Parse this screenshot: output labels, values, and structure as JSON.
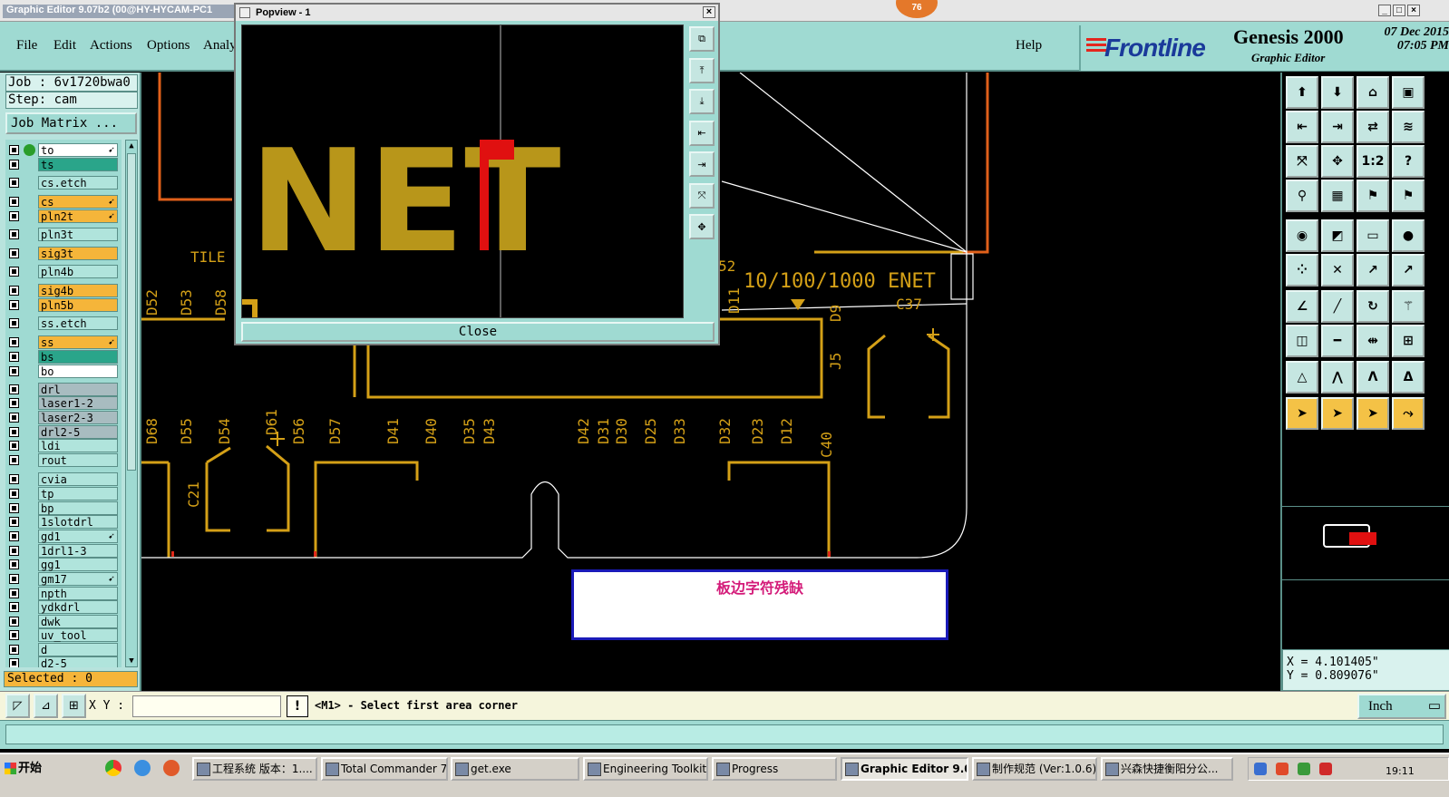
{
  "titlebar": {
    "title": "Graphic Editor 9.07b2 (00@HY-HYCAM-PC1",
    "badge": "76",
    "minimize": "_",
    "maximize": "□",
    "close": "×"
  },
  "menu": {
    "items": [
      "File",
      "Edit",
      "Actions",
      "Options",
      "Analy"
    ],
    "help": "Help"
  },
  "brand": {
    "logo": "Frontline",
    "product": "Genesis 2000",
    "subtitle": "Graphic Editor",
    "date": "07 Dec 2015",
    "time": "07:05 PM"
  },
  "job": {
    "job_label": "Job : 6v1720bwa0",
    "step_label": "Step: cam",
    "matrix_button": "Job Matrix ..."
  },
  "layers": [
    {
      "name": "to",
      "color": "white",
      "arrow": true,
      "active": true
    },
    {
      "name": "ts",
      "color": "teal"
    },
    {
      "name": "cs.etch",
      "color": "light"
    },
    {
      "name": "cs",
      "color": "orange",
      "arrow": true
    },
    {
      "name": "pln2t",
      "color": "orange",
      "arrow": true
    },
    {
      "name": "pln3t",
      "color": "light"
    },
    {
      "name": "sig3t",
      "color": "orange"
    },
    {
      "name": "pln4b",
      "color": "light"
    },
    {
      "name": "sig4b",
      "color": "orange"
    },
    {
      "name": "pln5b",
      "color": "orange"
    },
    {
      "name": "ss.etch",
      "color": "light"
    },
    {
      "name": "ss",
      "color": "orange",
      "arrow": true
    },
    {
      "name": "bs",
      "color": "teal"
    },
    {
      "name": "bo",
      "color": "white"
    },
    {
      "name": "drl",
      "color": "grey"
    },
    {
      "name": "laser1-2",
      "color": "grey"
    },
    {
      "name": "laser2-3",
      "color": "grey"
    },
    {
      "name": "drl2-5",
      "color": "grey"
    },
    {
      "name": "ldi",
      "color": "light"
    },
    {
      "name": "rout",
      "color": "light"
    },
    {
      "name": "cvia",
      "color": "light"
    },
    {
      "name": "tp",
      "color": "light"
    },
    {
      "name": "bp",
      "color": "light"
    },
    {
      "name": "1slotdrl",
      "color": "light"
    },
    {
      "name": "gd1",
      "color": "light",
      "arrow": true
    },
    {
      "name": "1drl1-3",
      "color": "light"
    },
    {
      "name": "gg1",
      "color": "light"
    },
    {
      "name": "gm17",
      "color": "light",
      "arrow": true
    },
    {
      "name": "npth",
      "color": "light"
    },
    {
      "name": "ydkdrl",
      "color": "light"
    },
    {
      "name": "dwk",
      "color": "light"
    },
    {
      "name": "uv_tool",
      "color": "light"
    },
    {
      "name": "d",
      "color": "light"
    },
    {
      "name": "d2-5",
      "color": "light"
    }
  ],
  "selected_label": "Selected : 0",
  "popup": {
    "title": "Popview - 1",
    "close_x": "×",
    "close_button": "Close",
    "text": "NET"
  },
  "canvas": {
    "labels_h": [
      "TILE",
      "10/100/1000 ENET"
    ],
    "labels_v_top": [
      "D52",
      "D53",
      "D58",
      "D11",
      "D9",
      "J5",
      "C37",
      "52"
    ],
    "labels_v_mid": [
      "D68",
      "D55",
      "D54",
      "D61",
      "D56",
      "D57",
      "D41",
      "D40",
      "D35",
      "D43",
      "D42",
      "D31",
      "D30",
      "D25",
      "D33",
      "D32",
      "D23",
      "D12",
      "C40",
      "C21"
    ],
    "annotation": "板边字符残缺"
  },
  "coords": {
    "x": "X = 4.101405\"",
    "y": "Y = 0.809076\""
  },
  "command": {
    "xy_label": "X Y :",
    "xy_value": "",
    "warn": "!",
    "message": "<M1> - Select first area corner",
    "units": "Inch"
  },
  "taskbar": {
    "start": "开始",
    "tasks": [
      {
        "label": "工程系统 版本：1...."
      },
      {
        "label": "Total Commander 7.0 ..."
      },
      {
        "label": "get.exe"
      },
      {
        "label": "Engineering Toolkit 9...."
      },
      {
        "label": "Progress"
      },
      {
        "label": "Graphic Editor 9.07...",
        "active": true
      },
      {
        "label": "制作规范 (Ver:1.0.6)"
      },
      {
        "label": "兴森快捷衡阳分公..."
      }
    ],
    "clock": "19:11"
  }
}
